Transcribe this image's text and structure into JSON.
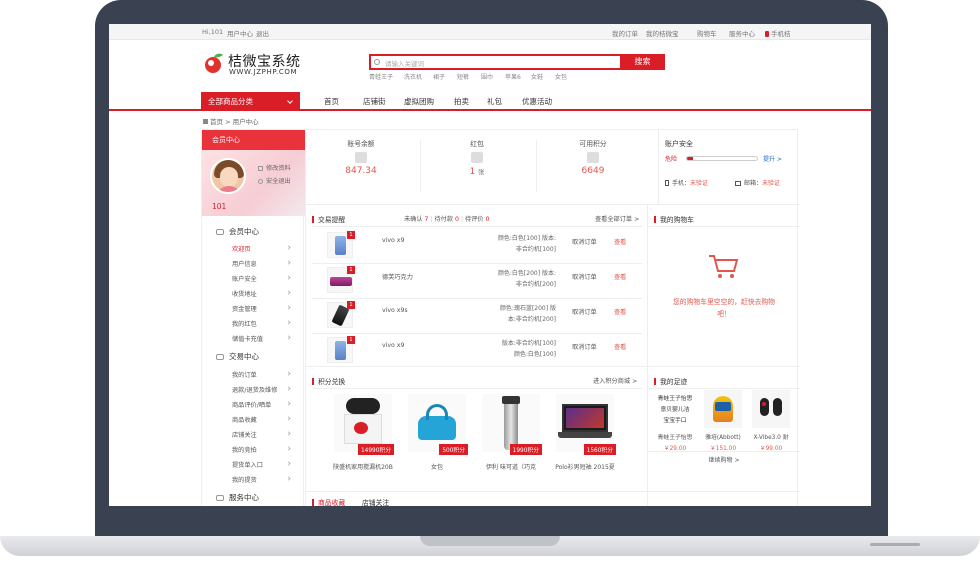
{
  "topbar": {
    "greeting": "Hi,101",
    "user_center": "用户中心",
    "logout": "退出",
    "my_orders": "我的订单",
    "my_shop": "我的桔微宝",
    "cart": "购物车",
    "service": "服务中心",
    "mobile": "手机桔"
  },
  "brand": {
    "name": "桔微宝系统",
    "url": "WWW.JZPHP.COM"
  },
  "search": {
    "placeholder": "请输入关键词",
    "button": "搜索",
    "hot": [
      "青蛙王子",
      "洗衣机",
      "裙子",
      "短裤",
      "围巾",
      "苹果6",
      "女鞋",
      "女包"
    ]
  },
  "nav": {
    "all_categories": "全部商品分类",
    "items": [
      "首页",
      "店铺街",
      "虚拟团购",
      "拍卖",
      "礼包",
      "优惠活动"
    ]
  },
  "breadcrumb": {
    "home": "首页",
    "sep": ">",
    "current": "用户中心"
  },
  "sidebar": {
    "header": "会员中心",
    "uid": "101",
    "edit_profile": "修改资料",
    "safe_logout": "安全退出",
    "groups": [
      {
        "title": "会员中心",
        "items": [
          "欢迎页",
          "用户信息",
          "账户安全",
          "收货地址",
          "资金管理",
          "我的红包",
          "储值卡充值"
        ]
      },
      {
        "title": "交易中心",
        "items": [
          "我的订单",
          "退款/退货及维修",
          "商品评价/晒单",
          "商品收藏",
          "店铺关注",
          "我的竞拍",
          "提货单入口",
          "我的提货"
        ]
      },
      {
        "title": "服务中心",
        "items": []
      }
    ]
  },
  "stats": [
    {
      "label": "账号余额",
      "value": "847.34",
      "unit": ""
    },
    {
      "label": "红包",
      "value": "1",
      "unit": "张"
    },
    {
      "label": "可用积分",
      "value": "6649",
      "unit": ""
    }
  ],
  "account_security": {
    "title": "账户安全",
    "level": "危险",
    "level_fraction": 0.08,
    "upgrade": "提升 >",
    "phone_label": "手机：",
    "phone_status": "未验证",
    "email_label": "邮箱：",
    "email_status": "未验证"
  },
  "orders": {
    "title": "交易提醒",
    "unconfirmed_label": "未确认",
    "unconfirmed": "7",
    "unpaid_label": "待付款",
    "unpaid": "0",
    "unreviewed_label": "待评价",
    "unreviewed": "0",
    "view_all": "查看全部订单 >",
    "rows": [
      {
        "name": "vivo x9",
        "spec1": "颜色:白色[100] 版本:",
        "spec2": "非合约机[100]",
        "cancel": "取消订单",
        "view": "查看"
      },
      {
        "name": "德芙巧克力",
        "spec1": "颜色:白色[200] 版本:",
        "spec2": "非合约机[200]",
        "cancel": "取消订单",
        "view": "查看"
      },
      {
        "name": "vivo x9s",
        "spec1": "颜色:瑰石蓝[200] 版",
        "spec2": "本:非合约机[200]",
        "cancel": "取消订单",
        "view": "查看"
      },
      {
        "name": "vivo x9",
        "spec1": "版本:非合约机[100]",
        "spec2": "颜色:白色[100]",
        "cancel": "取消订单",
        "view": "查看"
      }
    ]
  },
  "my_cart": {
    "title": "我的购物车",
    "empty_msg": "您的购物车里空空的，赶快去购物吧！"
  },
  "points_exchange": {
    "title": "积分兑换",
    "more": "进入积分商城 >",
    "items": [
      {
        "name": "陕盛机家用搅漏机20B",
        "price": "14990积分"
      },
      {
        "name": "女包",
        "price": "500积分"
      },
      {
        "name": "伊利 味可道（巧克",
        "price": "1990积分"
      },
      {
        "name": "Polo衫男短袖 2015夏",
        "price": "1560积分"
      }
    ]
  },
  "footprints": {
    "title": "我的足迹",
    "more": "继续购物 >",
    "items": [
      {
        "name": "青蛙王子怡思",
        "price": "￥29.00"
      },
      {
        "name": "雅培(Abbott)",
        "price": "￥151.00"
      },
      {
        "name": "X-Vibe3.0 耐",
        "price": "￥99.00"
      }
    ],
    "first_desc": [
      "青蛙王子怡思",
      "意贝婴儿洁",
      "宝宝手口"
    ]
  },
  "bottom_tabs": [
    "商品收藏",
    "店铺关注"
  ],
  "colors": {
    "accent": "#d91e27",
    "price": "#e2574c",
    "link": "#1e64c8"
  }
}
